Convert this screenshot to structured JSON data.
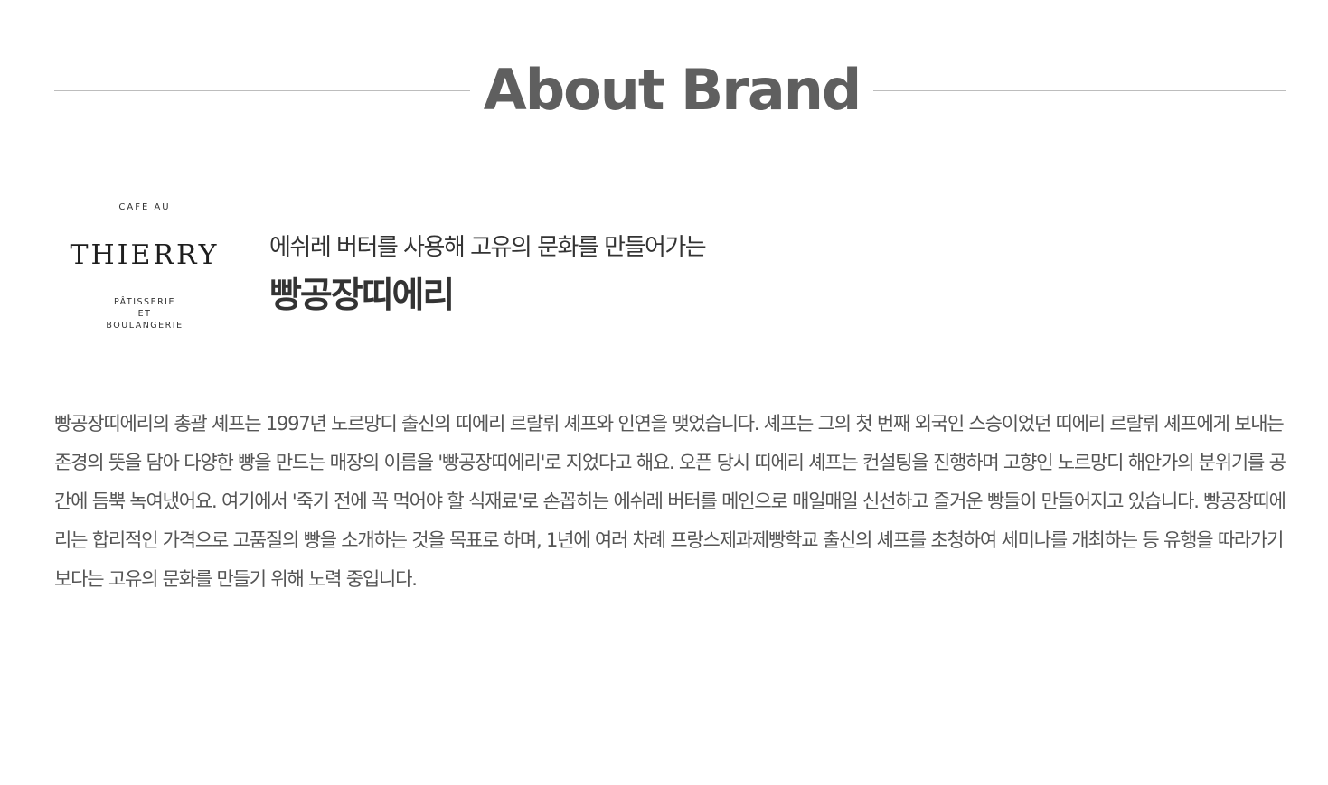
{
  "section": {
    "title": "About Brand"
  },
  "logo": {
    "top": "CAFE AU",
    "main": "THIERRY",
    "sub": [
      "PÂTISSERIE",
      "ET",
      "BOULANGERIE"
    ]
  },
  "intro": {
    "tagline": "에쉬레 버터를 사용해 고유의 문화를 만들어가는",
    "brand_name": "빵공장띠에리"
  },
  "description": "빵공장띠에리의 총괄 셰프는 1997년 노르망디 출신의 띠에리 르랄뤼 셰프와 인연을 맺었습니다. 셰프는 그의 첫 번째 외국인 스승이었던 띠에리 르랄뤼 셰프에게 보내는 존경의 뜻을 담아 다양한 빵을 만드는 매장의 이름을 '빵공장띠에리'로 지었다고 해요. 오픈 당시 띠에리 셰프는 컨설팅을 진행하며 고향인 노르망디 해안가의 분위기를 공간에 듬뿍 녹여냈어요. 여기에서 '죽기 전에 꼭 먹어야 할 식재료'로 손꼽히는 에쉬레 버터를 메인으로 매일매일 신선하고 즐거운 빵들이 만들어지고 있습니다. 빵공장띠에리는 합리적인 가격으로 고품질의 빵을 소개하는 것을 목표로 하며, 1년에 여러 차례 프랑스제과제빵학교 출신의 셰프를 초청하여 세미나를 개최하는 등 유행을 따라가기보다는 고유의 문화를 만들기 위해 노력 중입니다."
}
